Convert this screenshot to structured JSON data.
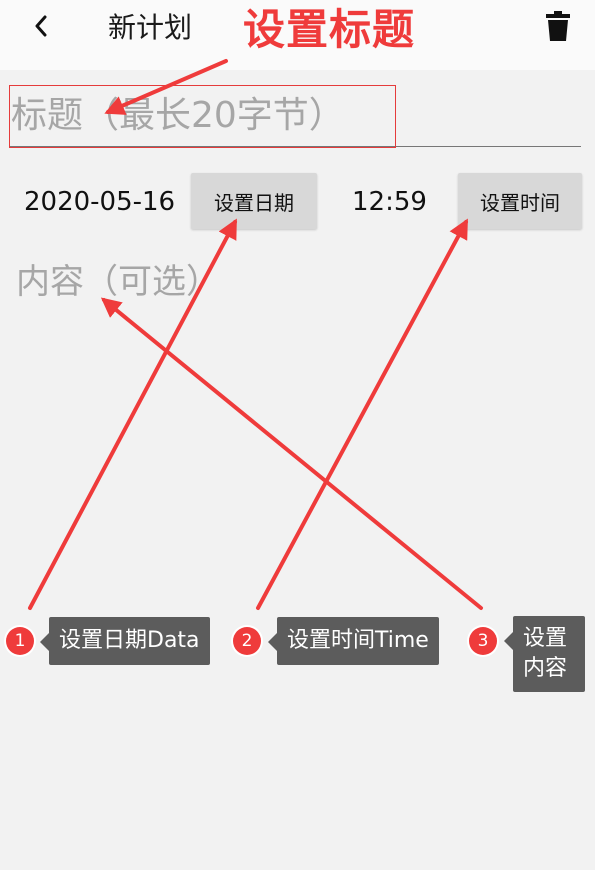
{
  "header": {
    "title": "新计划",
    "back_icon": "chevron-left-icon",
    "delete_icon": "trash-icon"
  },
  "annotation_title": "设置标题",
  "form": {
    "title_placeholder": "标题（最长20字节）",
    "date_value": "2020-05-16",
    "set_date_label": "设置日期",
    "time_value": "12:59",
    "set_time_label": "设置时间",
    "content_placeholder": "内容（可选）"
  },
  "steps": [
    {
      "number": "1",
      "label": "设置日期Data"
    },
    {
      "number": "2",
      "label": "设置时间Time"
    },
    {
      "number": "3",
      "label": "设置内容"
    }
  ],
  "colors": {
    "annotation_red": "#ef3b3b",
    "tooltip_gray": "#5c5c5c",
    "button_gray": "#d8d8d8",
    "background": "#f2f2f2"
  }
}
